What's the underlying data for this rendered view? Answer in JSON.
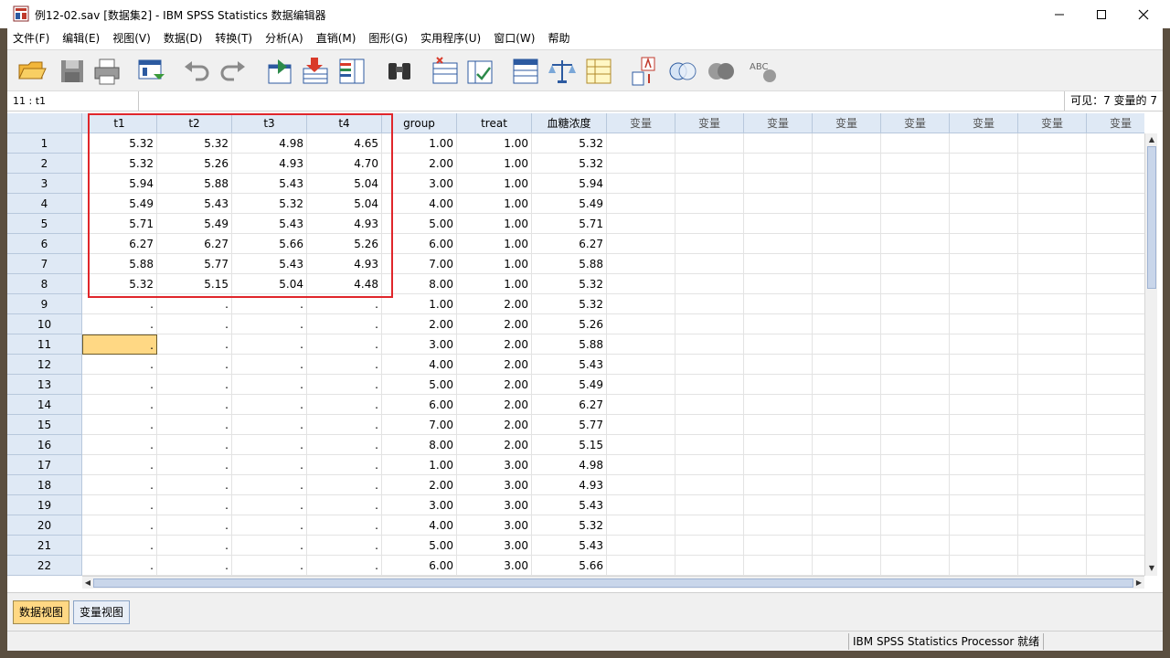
{
  "window": {
    "title": "例12-02.sav [数据集2] - IBM SPSS Statistics 数据编辑器"
  },
  "menu": [
    "文件(F)",
    "编辑(E)",
    "视图(V)",
    "数据(D)",
    "转换(T)",
    "分析(A)",
    "直销(M)",
    "图形(G)",
    "实用程序(U)",
    "窗口(W)",
    "帮助"
  ],
  "toolbar_icons": [
    "open-folder-icon",
    "save-icon",
    "print-icon",
    "recall-dialog-icon",
    "undo-icon",
    "redo-icon",
    "go-to-case-icon",
    "insert-case-icon",
    "variables-icon",
    "find-icon",
    "split-file-icon",
    "weight-cases-icon",
    "select-cases-icon",
    "scale-icon",
    "value-labels-icon",
    "use-sets-icon",
    "show-sets-icon",
    "spelling-icon"
  ],
  "editor": {
    "cell_ref": "11 : t1",
    "visible": "可见：7 变量的 7"
  },
  "grid": {
    "columns": [
      "t1",
      "t2",
      "t3",
      "t4",
      "group",
      "treat",
      "血糖浓度",
      "变量",
      "变量",
      "变量",
      "变量",
      "变量",
      "变量",
      "变量",
      "变量"
    ],
    "row_labels": [
      "1",
      "2",
      "3",
      "4",
      "5",
      "6",
      "7",
      "8",
      "9",
      "10",
      "11",
      "12",
      "13",
      "14",
      "15",
      "16",
      "17",
      "18",
      "19",
      "20",
      "21",
      "22"
    ],
    "rows": [
      [
        "5.32",
        "5.32",
        "4.98",
        "4.65",
        "1.00",
        "1.00",
        "5.32"
      ],
      [
        "5.32",
        "5.26",
        "4.93",
        "4.70",
        "2.00",
        "1.00",
        "5.32"
      ],
      [
        "5.94",
        "5.88",
        "5.43",
        "5.04",
        "3.00",
        "1.00",
        "5.94"
      ],
      [
        "5.49",
        "5.43",
        "5.32",
        "5.04",
        "4.00",
        "1.00",
        "5.49"
      ],
      [
        "5.71",
        "5.49",
        "5.43",
        "4.93",
        "5.00",
        "1.00",
        "5.71"
      ],
      [
        "6.27",
        "6.27",
        "5.66",
        "5.26",
        "6.00",
        "1.00",
        "6.27"
      ],
      [
        "5.88",
        "5.77",
        "5.43",
        "4.93",
        "7.00",
        "1.00",
        "5.88"
      ],
      [
        "5.32",
        "5.15",
        "5.04",
        "4.48",
        "8.00",
        "1.00",
        "5.32"
      ],
      [
        ".",
        ".",
        ".",
        ".",
        "1.00",
        "2.00",
        "5.32"
      ],
      [
        ".",
        ".",
        ".",
        ".",
        "2.00",
        "2.00",
        "5.26"
      ],
      [
        ".",
        ".",
        ".",
        ".",
        "3.00",
        "2.00",
        "5.88"
      ],
      [
        ".",
        ".",
        ".",
        ".",
        "4.00",
        "2.00",
        "5.43"
      ],
      [
        ".",
        ".",
        ".",
        ".",
        "5.00",
        "2.00",
        "5.49"
      ],
      [
        ".",
        ".",
        ".",
        ".",
        "6.00",
        "2.00",
        "6.27"
      ],
      [
        ".",
        ".",
        ".",
        ".",
        "7.00",
        "2.00",
        "5.77"
      ],
      [
        ".",
        ".",
        ".",
        ".",
        "8.00",
        "2.00",
        "5.15"
      ],
      [
        ".",
        ".",
        ".",
        ".",
        "1.00",
        "3.00",
        "4.98"
      ],
      [
        ".",
        ".",
        ".",
        ".",
        "2.00",
        "3.00",
        "4.93"
      ],
      [
        ".",
        ".",
        ".",
        ".",
        "3.00",
        "3.00",
        "5.43"
      ],
      [
        ".",
        ".",
        ".",
        ".",
        "4.00",
        "3.00",
        "5.32"
      ],
      [
        ".",
        ".",
        ".",
        ".",
        "5.00",
        "3.00",
        "5.43"
      ],
      [
        ".",
        ".",
        ".",
        ".",
        "6.00",
        "3.00",
        "5.66"
      ]
    ],
    "selected_row": 10,
    "selected_col": 0
  },
  "tabs": {
    "data_view": "数据视图",
    "variable_view": "变量视图"
  },
  "status": {
    "processor": "IBM SPSS Statistics Processor 就绪"
  },
  "colors": {
    "selection": "#ffd884",
    "highlight_box": "#e0262b",
    "header_bg": "#dfe9f5"
  }
}
